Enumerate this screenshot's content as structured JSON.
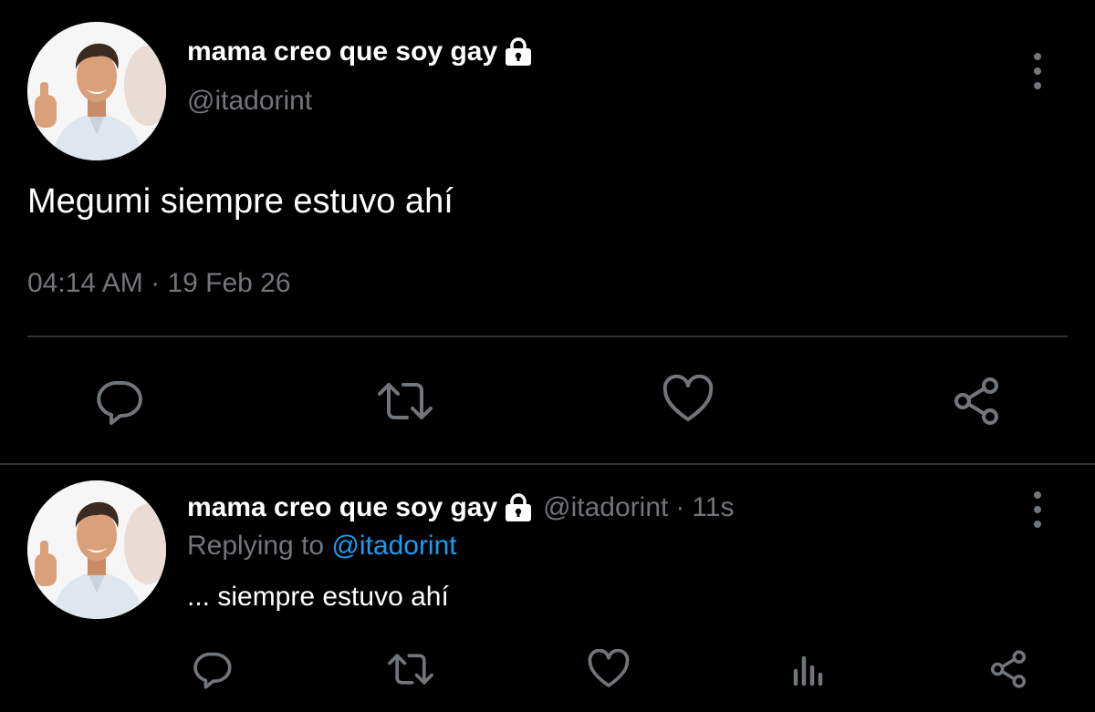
{
  "tweet": {
    "display_name": "mama creo que soy gay",
    "handle": "@itadorint",
    "text": "Megumi siempre estuvo ahí",
    "time": "04:14 AM",
    "separator": "·",
    "date": "19 Feb 26",
    "protected_icon": "lock-icon",
    "actions": [
      "reply-icon",
      "retweet-icon",
      "like-icon",
      "share-icon"
    ]
  },
  "reply": {
    "display_name": "mama creo que soy gay",
    "handle": "@itadorint",
    "separator": "·",
    "age": "11s",
    "replying_prefix": "Replying to",
    "replying_to": "@itadorint",
    "text": "... siempre estuvo ahí",
    "actions": [
      "reply-icon",
      "retweet-icon",
      "like-icon",
      "analytics-icon",
      "share-icon"
    ]
  },
  "colors": {
    "background": "#000000",
    "text": "#e7e9ea",
    "muted": "#71767b",
    "link": "#1d9bf0",
    "divider": "#2f3336"
  }
}
